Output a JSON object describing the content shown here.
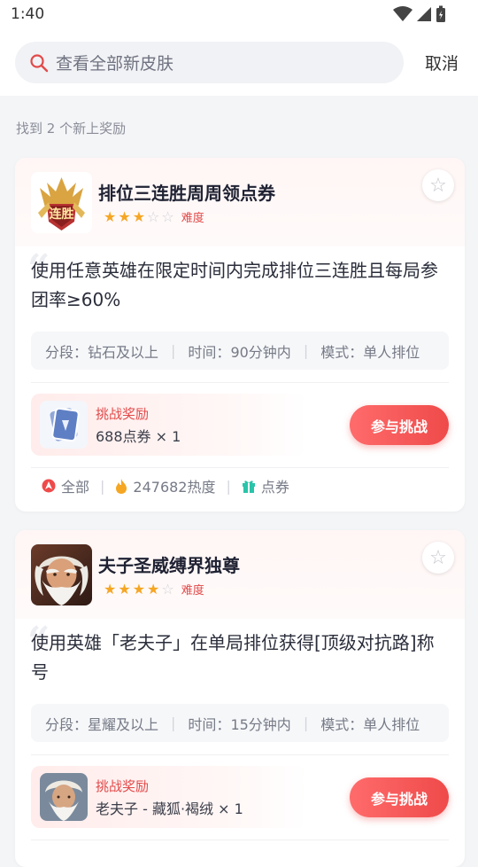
{
  "status": {
    "time": "1:40"
  },
  "search": {
    "placeholder": "查看全部新皮肤",
    "cancel": "取消"
  },
  "result_text": "找到 2 个新上奖励",
  "cards": [
    {
      "title": "排位三连胜周周领点券",
      "stars": 3,
      "stars_max": 5,
      "difficulty_label": "难度",
      "description": "使用任意英雄在限定时间内完成排位三连胜且每局参团率≥60%",
      "meta": {
        "tier_label": "分段：",
        "tier": "钻石及以上",
        "time_label": "时间：",
        "time": "90分钟内",
        "mode_label": "模式：",
        "mode": "单人排位"
      },
      "reward": {
        "label": "挑战奖励",
        "value": "688点券 × 1"
      },
      "button": "参与挑战",
      "stats": {
        "scope": "全部",
        "heat": "247682热度",
        "type": "点券"
      }
    },
    {
      "title": "夫子圣威缚界独尊",
      "stars": 4,
      "stars_max": 5,
      "difficulty_label": "难度",
      "description": "使用英雄「老夫子」在单局排位获得[顶级对抗路]称号",
      "meta": {
        "tier_label": "分段：",
        "tier": "星耀及以上",
        "time_label": "时间：",
        "time": "15分钟内",
        "mode_label": "模式：",
        "mode": "单人排位"
      },
      "reward": {
        "label": "挑战奖励",
        "value": "老夫子 - 藏狐·褐绒 × 1"
      },
      "button": "参与挑战"
    }
  ],
  "colors": {
    "accent": "#ef4a4a",
    "star": "#f5a623",
    "coupon": "#29c4a9"
  }
}
